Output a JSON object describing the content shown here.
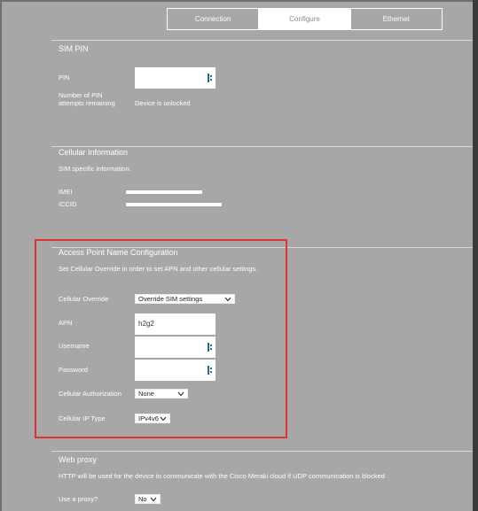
{
  "tabs": [
    {
      "label": "Connection",
      "active": false
    },
    {
      "label": "Configure",
      "active": true
    },
    {
      "label": "Ethernet",
      "active": false
    }
  ],
  "sim_pin": {
    "heading": "SIM PIN",
    "pin_label": "PIN",
    "pin_value": "",
    "attempts_label_line1": "Number of PIN",
    "attempts_label_line2": "attempts remaining",
    "attempts_value": "Device is unlocked"
  },
  "cellular_info": {
    "heading": "Cellular Information",
    "description": "SIM specific information.",
    "imei_label": "IMEI",
    "iccid_label": "ICCID"
  },
  "apn_config": {
    "heading": "Access Point Name Configuration",
    "description": "Set Cellular Override in order to set APN and other cellular settings.",
    "override_label": "Cellular Override",
    "override_value": "Override SIM settings",
    "apn_label": "APN",
    "apn_value": "h2g2",
    "username_label": "Username",
    "username_value": "",
    "password_label": "Password",
    "password_value": "",
    "auth_label": "Cellular Authorization",
    "auth_value": "None",
    "ip_type_label": "Cellular IP Type",
    "ip_type_value": "IPv4v6"
  },
  "web_proxy": {
    "heading": "Web proxy",
    "description": "HTTP will be used for the device to communicate with the Cisco Meraki cloud if UDP communication is blocked",
    "use_proxy_label": "Use a proxy?",
    "use_proxy_value": "No"
  },
  "colors": {
    "background": "#a7a7a7",
    "highlight_box": "#e03232",
    "password_icon": "#1f6f8b"
  },
  "icons": {
    "field_icon": "password-manager-icon",
    "select_icon": "chevron-down-icon"
  }
}
